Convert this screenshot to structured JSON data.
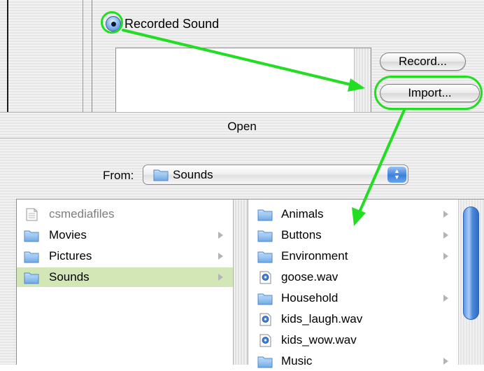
{
  "sound_dialog": {
    "radio_label": "Recorded Sound",
    "radio_selected": true,
    "record_button": "Record...",
    "import_button": "Import..."
  },
  "open_dialog": {
    "title": "Open",
    "from_label": "From:",
    "from_value": "Sounds",
    "column1": {
      "items": [
        {
          "label": "csmediafiles",
          "icon": "document-icon",
          "dimmed": true,
          "has_children": false,
          "selected": false
        },
        {
          "label": "Movies",
          "icon": "folder-icon",
          "dimmed": false,
          "has_children": true,
          "selected": false
        },
        {
          "label": "Pictures",
          "icon": "folder-icon",
          "dimmed": false,
          "has_children": true,
          "selected": false
        },
        {
          "label": "Sounds",
          "icon": "folder-icon",
          "dimmed": false,
          "has_children": true,
          "selected": true
        }
      ]
    },
    "column2": {
      "items": [
        {
          "label": "Animals",
          "icon": "folder-icon",
          "has_children": true
        },
        {
          "label": "Buttons",
          "icon": "folder-icon",
          "has_children": true
        },
        {
          "label": "Environment",
          "icon": "folder-icon",
          "has_children": true
        },
        {
          "label": "goose.wav",
          "icon": "sound-file-icon",
          "has_children": false
        },
        {
          "label": "Household",
          "icon": "folder-icon",
          "has_children": true
        },
        {
          "label": "kids_laugh.wav",
          "icon": "sound-file-icon",
          "has_children": false
        },
        {
          "label": "kids_wow.wav",
          "icon": "sound-file-icon",
          "has_children": false
        },
        {
          "label": "Music",
          "icon": "folder-icon",
          "has_children": true
        }
      ]
    }
  },
  "colors": {
    "highlight_green": "#22dd22",
    "selection_green": "#d3e6b6",
    "aqua_blue": "#3d7fd9"
  }
}
